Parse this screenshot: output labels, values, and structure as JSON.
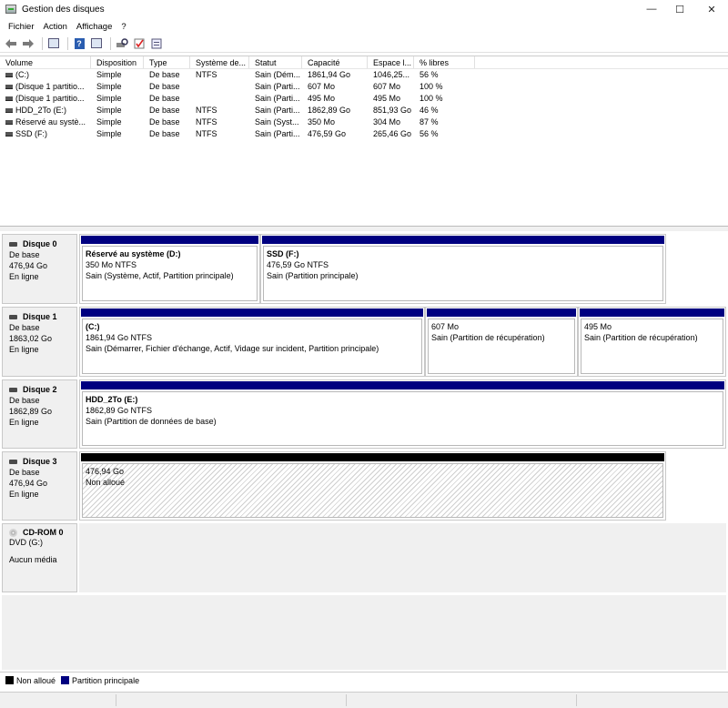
{
  "window": {
    "title": "Gestion des disques",
    "minimize": "—",
    "maximize": "☐",
    "close": "✕"
  },
  "menu": [
    "Fichier",
    "Action",
    "Affichage",
    "?"
  ],
  "volumes": {
    "headers": [
      "Volume",
      "Disposition",
      "Type",
      "Système de...",
      "Statut",
      "Capacité",
      "Espace l...",
      "% libres"
    ],
    "rows": [
      [
        "(C:)",
        "Simple",
        "De base",
        "NTFS",
        "Sain (Dém...",
        "1861,94 Go",
        "1046,25...",
        "56 %"
      ],
      [
        "(Disque 1 partitio...",
        "Simple",
        "De base",
        "",
        "Sain (Parti...",
        "607 Mo",
        "607 Mo",
        "100 %"
      ],
      [
        "(Disque 1 partitio...",
        "Simple",
        "De base",
        "",
        "Sain (Parti...",
        "495 Mo",
        "495 Mo",
        "100 %"
      ],
      [
        "HDD_2To (E:)",
        "Simple",
        "De base",
        "NTFS",
        "Sain (Parti...",
        "1862,89 Go",
        "851,93 Go",
        "46 %"
      ],
      [
        "Réservé au systè...",
        "Simple",
        "De base",
        "NTFS",
        "Sain (Syst...",
        "350 Mo",
        "304 Mo",
        "87 %"
      ],
      [
        "SSD (F:)",
        "Simple",
        "De base",
        "NTFS",
        "Sain (Parti...",
        "476,59 Go",
        "265,46 Go",
        "56 %"
      ]
    ]
  },
  "disks": [
    {
      "name": "Disque 0",
      "type": "De base",
      "size": "476,94 Go",
      "status": "En ligne",
      "partitions": [
        {
          "name": "Réservé au système  (D:)",
          "size": "350 Mo NTFS",
          "status": "Sain (Système, Actif, Partition principale)"
        },
        {
          "name": "SSD  (F:)",
          "size": "476,59 Go NTFS",
          "status": "Sain (Partition principale)"
        }
      ]
    },
    {
      "name": "Disque 1",
      "type": "De base",
      "size": "1863,02 Go",
      "status": "En ligne",
      "partitions": [
        {
          "name": "(C:)",
          "size": "1861,94 Go NTFS",
          "status": "Sain (Démarrer, Fichier d'échange, Actif, Vidage sur incident, Partition principale)"
        },
        {
          "name": "",
          "size": "607 Mo",
          "status": "Sain (Partition de récupération)"
        },
        {
          "name": "",
          "size": "495 Mo",
          "status": "Sain (Partition de récupération)"
        }
      ]
    },
    {
      "name": "Disque 2",
      "type": "De base",
      "size": "1862,89 Go",
      "status": "En ligne",
      "partitions": [
        {
          "name": "HDD_2To  (E:)",
          "size": "1862,89 Go NTFS",
          "status": "Sain (Partition de données de base)"
        }
      ]
    },
    {
      "name": "Disque 3",
      "type": "De base",
      "size": "476,94 Go",
      "status": "En ligne",
      "partitions": [
        {
          "name": "",
          "size": "476,94 Go",
          "status": "Non alloué"
        }
      ]
    }
  ],
  "cdrom": {
    "name": "CD-ROM 0",
    "drive": "DVD (G:)",
    "status": "Aucun média"
  },
  "legend": [
    {
      "label": "Non alloué",
      "color": "#000000"
    },
    {
      "label": "Partition principale",
      "color": "#000080"
    }
  ]
}
